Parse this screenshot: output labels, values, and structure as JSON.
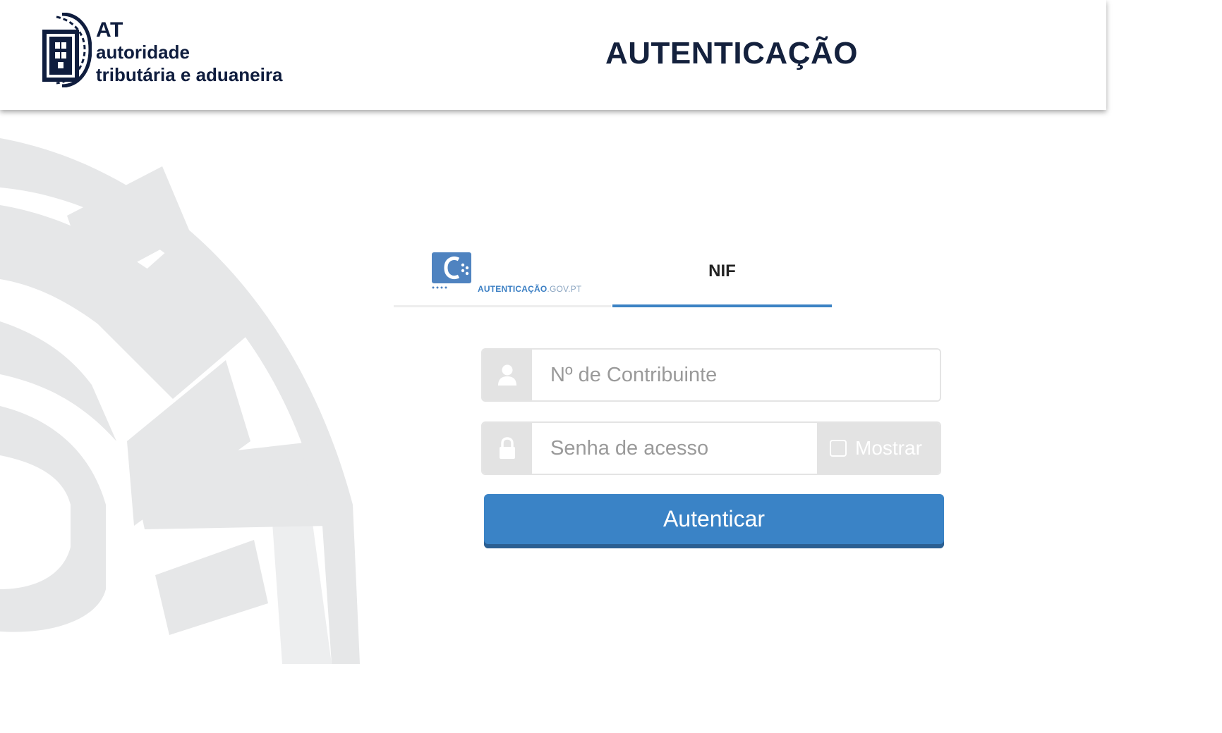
{
  "header": {
    "logo": {
      "abbr": "AT",
      "line1": "autoridade",
      "line2": "tributária e aduaneira"
    },
    "title": "AUTENTICAÇÃO"
  },
  "tabs": {
    "gov": {
      "name_bold": "AUTENTICAÇÃO",
      "name_light": ".GOV.PT",
      "active": false
    },
    "nif": {
      "label": "NIF",
      "active": true
    }
  },
  "form": {
    "nif_field": {
      "placeholder": "Nº de Contribuinte",
      "value": ""
    },
    "password_field": {
      "placeholder": "Senha de acesso",
      "value": ""
    },
    "show_password": {
      "label": "Mostrar",
      "checked": false
    },
    "submit_label": "Autenticar"
  },
  "colors": {
    "brand_navy": "#14213d",
    "accent_blue": "#3a83c6",
    "accent_blue_dark": "#2b5f92",
    "addon_gray": "#e3e3e3",
    "decoration_gray": "#e6e7e8"
  },
  "icons": {
    "user": "user-icon",
    "lock": "lock-icon",
    "logo": "at-shield-logo",
    "gov_logo": "autenticacao-gov-logo"
  }
}
